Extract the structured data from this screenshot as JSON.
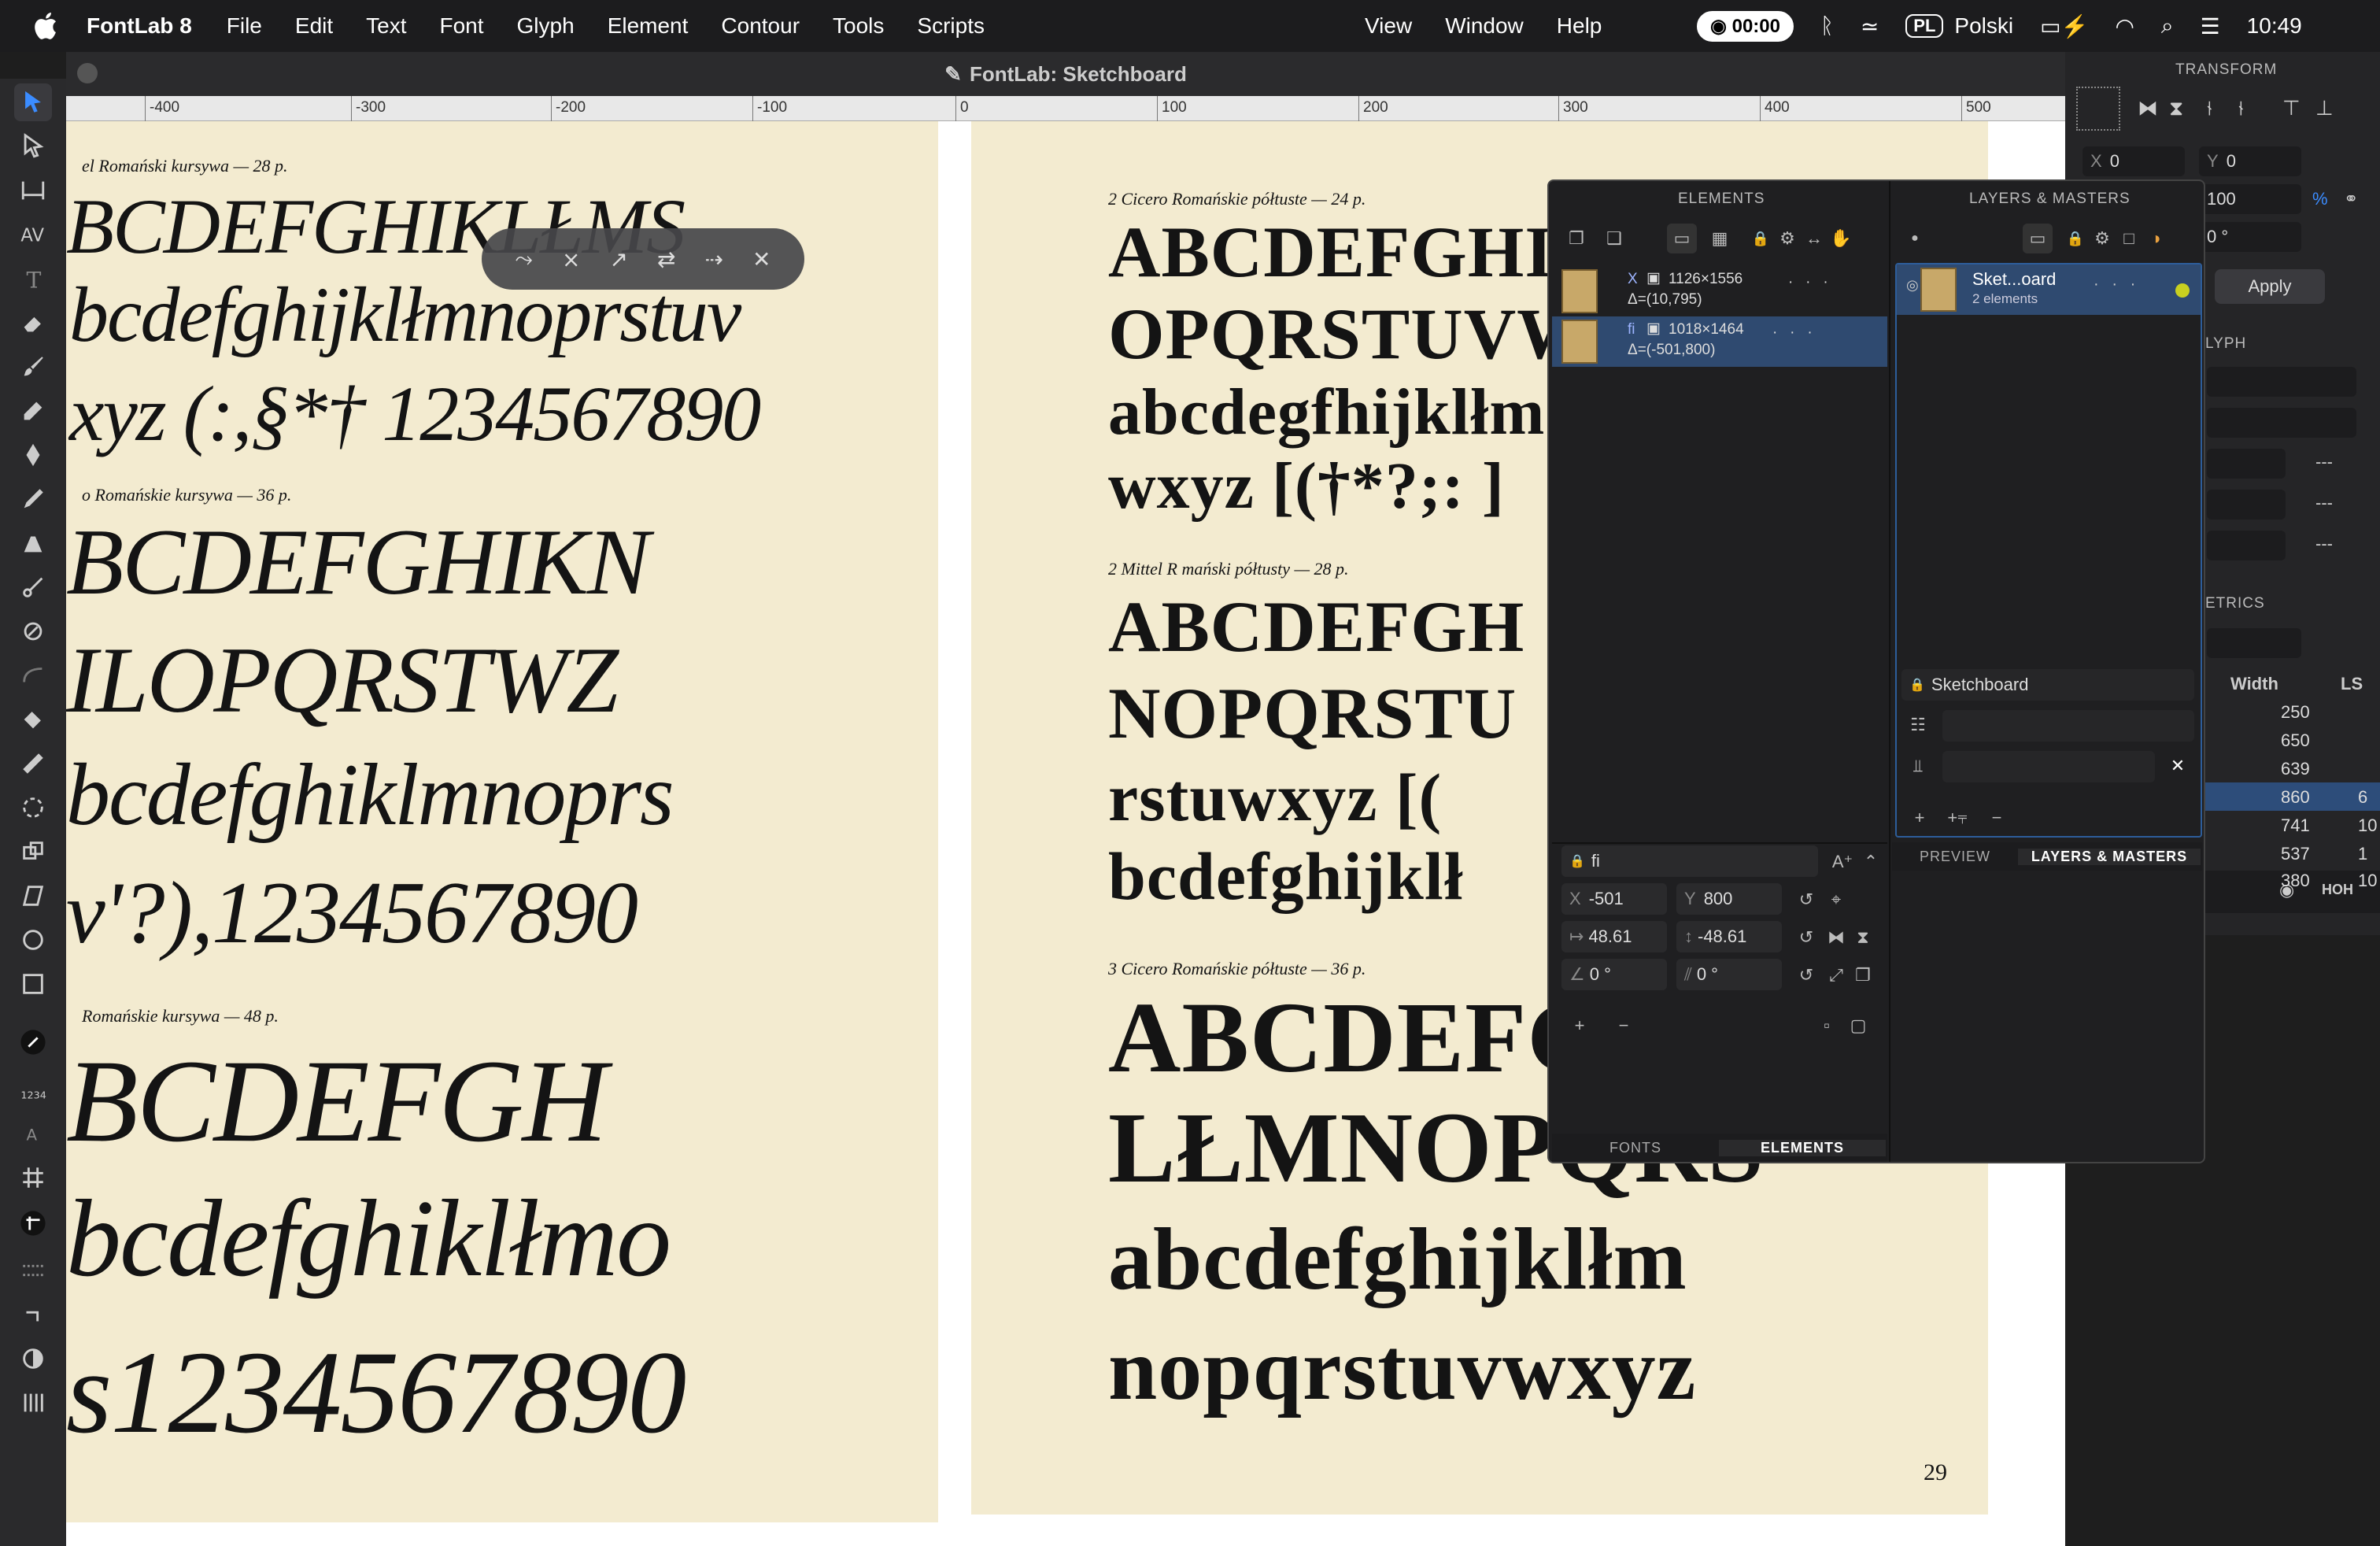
{
  "menubar": {
    "app_name": "FontLab 8",
    "menus": [
      "File",
      "Edit",
      "Text",
      "Font",
      "Glyph",
      "Element",
      "Contour",
      "Tools",
      "Scripts"
    ],
    "menus_right": [
      "View",
      "Window",
      "Help"
    ],
    "timer": "00:00",
    "input_source": "PL",
    "language": "Polski",
    "clock": "10:49"
  },
  "window": {
    "title": "FontLab: Sketchboard"
  },
  "ruler": {
    "labels": [
      "-400",
      "-300",
      "-200",
      "-100",
      "0",
      "100",
      "200",
      "300",
      "400",
      "500"
    ]
  },
  "specimen_left": {
    "blocks": [
      {
        "caption": "el Romański kursywa — 28 p.",
        "lines": [
          "BCDEFGHIKLŁMS",
          "bcdefghijklłmnoprstuv",
          "xyz (:,§*† 1234567890"
        ]
      },
      {
        "caption": "o Romańskie kursywa — 36 p.",
        "lines": [
          "BCDEFGHIKN",
          "ILOPQRSTWZ",
          "bcdefghiklmnoprs",
          "v'?),1234567890"
        ]
      },
      {
        "caption": "Romańskie kursywa — 48 p.",
        "lines": [
          "BCDEFGH",
          "bcdefghiklłmo",
          "s1234567890"
        ]
      }
    ]
  },
  "specimen_right": {
    "blocks": [
      {
        "caption": "2 Cicero Romańskie półtuste — 24 p.",
        "lines": [
          "ABCDEFGHIJ",
          "OPQRSTUVW",
          "abcdegfhijklłm",
          "wxyz [(†*?;: ]"
        ]
      },
      {
        "caption": "2 Mittel R mański półtusty — 28 p.",
        "lines": [
          "ABCDEFGH",
          "NOPQRSTU",
          "rstuwxyz [(",
          "bcdefghijklł"
        ]
      },
      {
        "caption": "3 Cicero Romańskie półtuste — 36 p.",
        "lines": [
          "ABCDEFG",
          "LŁMNOPQRS",
          "abcdefghijklłm",
          "nopqrstuvwxyz"
        ]
      }
    ],
    "page_number": "29"
  },
  "elements_panel": {
    "title": "ELEMENTS",
    "rows": [
      {
        "name": "X",
        "size": "1126×1556",
        "delta": "Δ=(10,795)",
        "selected": false
      },
      {
        "name": "fi",
        "size": "1018×1464",
        "delta": "Δ=(-501,800)",
        "selected": true
      }
    ],
    "element_name": "fi",
    "x_label": "X",
    "x_value": "-501",
    "y_label": "Y",
    "y_value": "800",
    "w_value": "48.61",
    "h_value": "-48.61",
    "rotate_value": "0 °",
    "slant_value": "0 °",
    "tabs": [
      "FONTS",
      "ELEMENTS"
    ],
    "active_tab": "ELEMENTS"
  },
  "layers_panel": {
    "title": "LAYERS & MASTERS",
    "layer_name": "Sket...oard",
    "layer_sub": "2 elements",
    "master_name": "Sketchboard",
    "tabs": [
      "PREVIEW",
      "LAYERS & MASTERS"
    ],
    "active_tab": "LAYERS & MASTERS"
  },
  "transform_panel": {
    "title": "TRANSFORM",
    "x_label": "X",
    "x_value": "0",
    "y_label": "Y",
    "y_value": "0",
    "scale_value": "100",
    "scale_unit": "%",
    "rotate_value": "0 °",
    "apply_label": "Apply",
    "glyph_title": "LYPH",
    "metrics_title": "ETRICS",
    "dash": "---",
    "width_header": "Width",
    "ls_header": "LS",
    "metrics": [
      {
        "width": "250",
        "ls": ""
      },
      {
        "width": "650",
        "ls": ""
      },
      {
        "width": "639",
        "ls": ""
      },
      {
        "width": "860",
        "ls": "6"
      },
      {
        "width": "741",
        "ls": "10"
      },
      {
        "width": "537",
        "ls": "1"
      },
      {
        "width": "380",
        "ls": "10"
      }
    ],
    "selected_metric_index": 3,
    "footer_label": "НОН"
  },
  "colors": {
    "accent": "#2d6bd6",
    "selection": "#2f4a70",
    "paper": "#f3ebd0",
    "status_dot": "#c8d020"
  }
}
